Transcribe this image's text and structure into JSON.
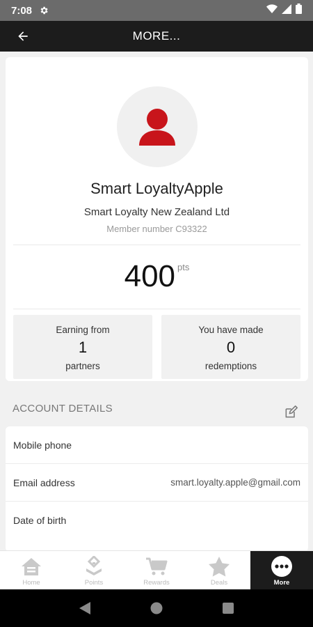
{
  "status_bar": {
    "time": "7:08"
  },
  "app_bar": {
    "title": "MORE..."
  },
  "profile": {
    "name": "Smart LoyaltyApple",
    "company": "Smart Loyalty New Zealand Ltd",
    "member_number": "Member number C93322",
    "points": "400",
    "points_unit": "pts"
  },
  "stats": {
    "earning": {
      "label": "Earning from",
      "value": "1",
      "sub": "partners"
    },
    "redemptions": {
      "label": "You have made",
      "value": "0",
      "sub": "redemptions"
    }
  },
  "account": {
    "header": "ACCOUNT DETAILS",
    "rows": [
      {
        "label": "Mobile phone",
        "value": ""
      },
      {
        "label": "Email address",
        "value": "smart.loyalty.apple@gmail.com"
      },
      {
        "label": "Date of birth",
        "value": ""
      }
    ]
  },
  "bottom_nav": {
    "items": [
      {
        "label": "Home",
        "icon": "home-icon"
      },
      {
        "label": "Points",
        "icon": "points-icon"
      },
      {
        "label": "Rewards",
        "icon": "cart-icon"
      },
      {
        "label": "Deals",
        "icon": "star-icon"
      },
      {
        "label": "More",
        "icon": "more-icon",
        "active": true
      }
    ]
  },
  "colors": {
    "accent_red": "#c8151b",
    "app_bar_bg": "#1c1c1c",
    "status_bar_bg": "#6b6b6b"
  }
}
